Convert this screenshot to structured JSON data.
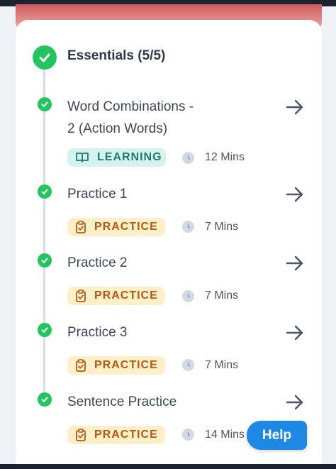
{
  "section": {
    "title": "Essentials (5/5)"
  },
  "lessons": [
    {
      "title_line1": "Word Combinations -",
      "title_line2": "2 (Action Words)",
      "tag": "LEARNING",
      "duration": "12 Mins"
    },
    {
      "title": "Practice 1",
      "tag": "PRACTICE",
      "duration": "7 Mins"
    },
    {
      "title": "Practice 2",
      "tag": "PRACTICE",
      "duration": "7 Mins"
    },
    {
      "title": "Practice 3",
      "tag": "PRACTICE",
      "duration": "7 Mins"
    },
    {
      "title": "Sentence Practice",
      "tag": "PRACTICE",
      "duration": "14 Mins"
    }
  ],
  "help": {
    "label": "Help"
  },
  "icons": {
    "check": "check-icon",
    "arrow": "arrow-right-icon",
    "learning": "book-icon",
    "practice": "clipboard-check-icon",
    "clock": "clock-icon"
  },
  "colors": {
    "success": "#22c55e",
    "learning_bg": "#d4f3ef",
    "learning_text": "#1f7a70",
    "practice_bg": "#fdf0c8",
    "practice_text": "#b45a14",
    "help_bg": "#1e88e5"
  }
}
